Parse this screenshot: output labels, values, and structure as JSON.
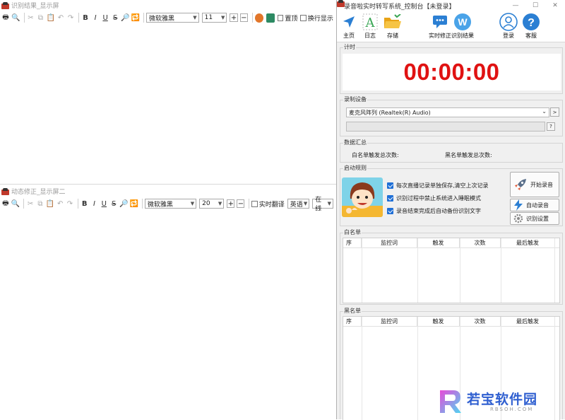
{
  "left_top": {
    "title": "识别结果_显示屏",
    "font_name": "微软雅黑",
    "font_size": "11",
    "opt_top": "置顶",
    "opt_wrap": "换行显示"
  },
  "left_bottom": {
    "title": "动态修正_显示屏二",
    "font_name": "微软雅黑",
    "font_size": "20",
    "opt_translate": "实时翻译",
    "language": "英语",
    "mode": "在线"
  },
  "format_buttons": {
    "bold": "B",
    "italic": "I",
    "underline": "U",
    "strike": "S",
    "plus": "+",
    "minus": "−"
  },
  "right": {
    "title": "录音啦实时转写系统_控制台【未登录】",
    "toolbar": {
      "home": "主页",
      "log": "日志",
      "save": "存储",
      "correct": "实时修正",
      "result": "识别结果",
      "login": "登录",
      "service": "客服"
    },
    "timer_group": "计时",
    "timer_value": "00:00:00",
    "device_group": "录制设备",
    "device_value": "麦克风阵列 (Realtek(R) Audio)",
    "help_btn": "?",
    "arrow_btn": ">",
    "data_group": "数据汇总",
    "white_count_label": "白名单触发总次数:",
    "black_count_label": "黑名单触发总次数:",
    "rules_group": "启动规则",
    "options": [
      "每次直播记录单独保存,清空上次记录",
      "识别过程中禁止系统进入睡眠模式",
      "录音结束完成后自动备份识别文字"
    ],
    "btn_start": "开始录音",
    "btn_auto": "自动录音",
    "btn_settings": "识别设置",
    "whitelist_group": "白名单",
    "blacklist_group": "黑名单",
    "columns": [
      "序",
      "监控词",
      "触发",
      "次数",
      "最后触发"
    ]
  },
  "watermark": {
    "brand": "若宝软件园",
    "url": "RBSOH.COM"
  }
}
